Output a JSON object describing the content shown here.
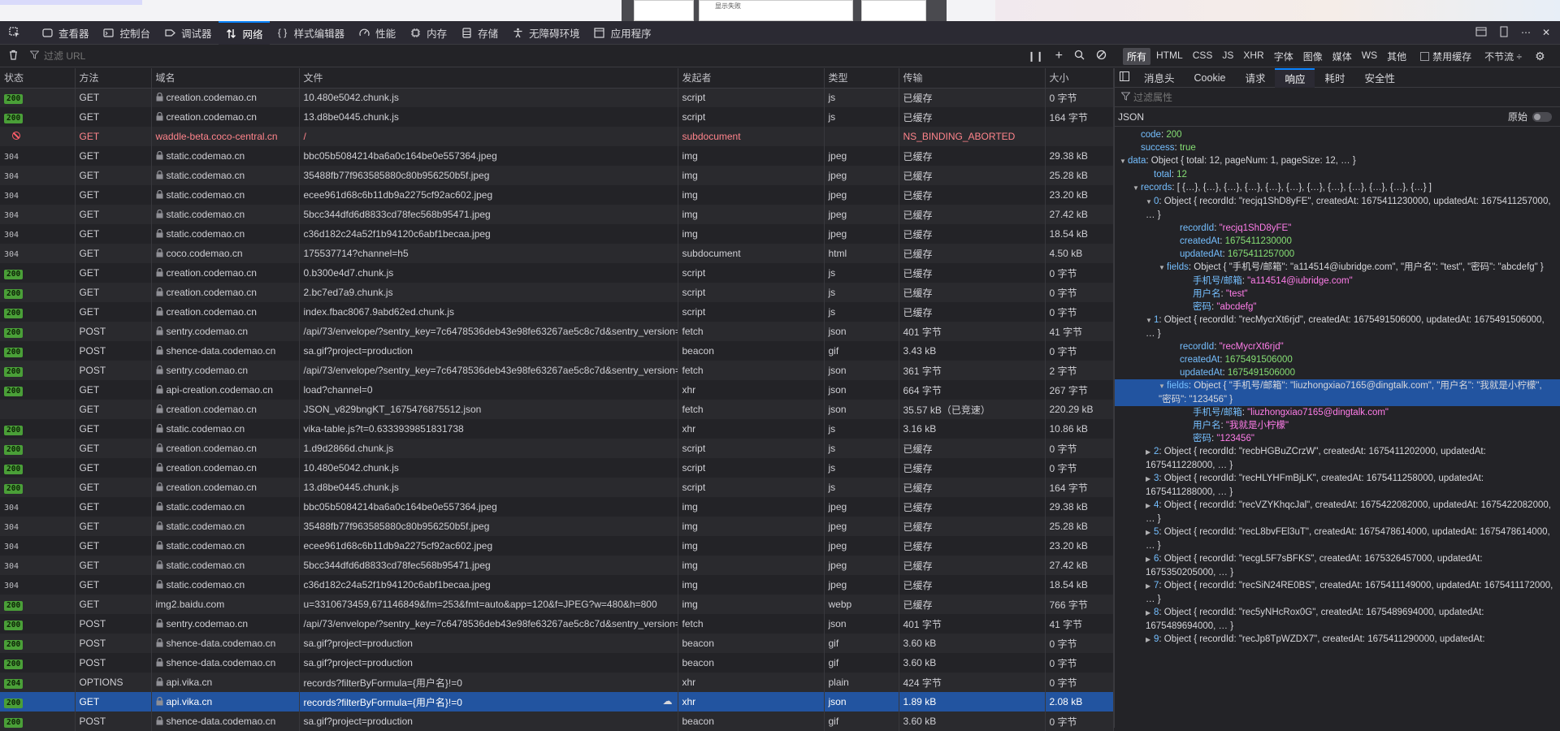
{
  "page_top": {
    "card_text": "显示失败"
  },
  "toolbar": {
    "tabs": [
      {
        "label": "查看器",
        "icon": "inspector-icon"
      },
      {
        "label": "控制台",
        "icon": "console-icon"
      },
      {
        "label": "调试器",
        "icon": "debugger-icon"
      },
      {
        "label": "网络",
        "icon": "network-icon",
        "selected": true
      },
      {
        "label": "样式编辑器",
        "icon": "style-editor-icon"
      },
      {
        "label": "性能",
        "icon": "performance-icon"
      },
      {
        "label": "内存",
        "icon": "memory-icon"
      },
      {
        "label": "存储",
        "icon": "storage-icon"
      },
      {
        "label": "无障碍环境",
        "icon": "accessibility-icon"
      },
      {
        "label": "应用程序",
        "icon": "application-icon"
      }
    ]
  },
  "filter": {
    "placeholder": "过滤 URL"
  },
  "type_filters": {
    "items": [
      "所有",
      "HTML",
      "CSS",
      "JS",
      "XHR",
      "字体",
      "图像",
      "媒体",
      "WS",
      "其他"
    ],
    "selected": "所有",
    "disable_cache": "禁用缓存",
    "throttle": "不节流 ÷"
  },
  "columns": {
    "status": "状态",
    "method": "方法",
    "domain": "域名",
    "file": "文件",
    "initiator": "发起者",
    "type": "类型",
    "transferred": "传输",
    "size": "大小"
  },
  "requests": [
    {
      "status": "200",
      "method": "GET",
      "domain": "creation.codemao.cn",
      "file": "10.480e5042.chunk.js",
      "initiator": "script",
      "type": "js",
      "transferred": "已缓存",
      "size": "0 字节"
    },
    {
      "status": "200",
      "method": "GET",
      "domain": "creation.codemao.cn",
      "file": "13.d8be0445.chunk.js",
      "initiator": "script",
      "type": "js",
      "transferred": "已缓存",
      "size": "164 字节"
    },
    {
      "status": "blocked",
      "method": "GET",
      "domain": "waddle-beta.coco-central.cn",
      "file": "/",
      "initiator": "subdocument",
      "type": "",
      "transferred": "NS_BINDING_ABORTED",
      "size": "",
      "nolock": true
    },
    {
      "status": "304",
      "method": "GET",
      "domain": "static.codemao.cn",
      "file": "bbc05b5084214ba6a0c164be0e557364.jpeg",
      "initiator": "img",
      "type": "jpeg",
      "transferred": "已缓存",
      "size": "29.38 kB"
    },
    {
      "status": "304",
      "method": "GET",
      "domain": "static.codemao.cn",
      "file": "35488fb77f963585880c80b956250b5f.jpeg",
      "initiator": "img",
      "type": "jpeg",
      "transferred": "已缓存",
      "size": "25.28 kB"
    },
    {
      "status": "304",
      "method": "GET",
      "domain": "static.codemao.cn",
      "file": "ecee961d68c6b11db9a2275cf92ac602.jpeg",
      "initiator": "img",
      "type": "jpeg",
      "transferred": "已缓存",
      "size": "23.20 kB"
    },
    {
      "status": "304",
      "method": "GET",
      "domain": "static.codemao.cn",
      "file": "5bcc344dfd6d8833cd78fec568b95471.jpeg",
      "initiator": "img",
      "type": "jpeg",
      "transferred": "已缓存",
      "size": "27.42 kB"
    },
    {
      "status": "304",
      "method": "GET",
      "domain": "static.codemao.cn",
      "file": "c36d182c24a52f1b94120c6abf1becaa.jpeg",
      "initiator": "img",
      "type": "jpeg",
      "transferred": "已缓存",
      "size": "18.54 kB"
    },
    {
      "status": "304",
      "method": "GET",
      "domain": "coco.codemao.cn",
      "file": "175537714?channel=h5",
      "initiator": "subdocument",
      "type": "html",
      "transferred": "已缓存",
      "size": "4.50 kB"
    },
    {
      "status": "200",
      "method": "GET",
      "domain": "creation.codemao.cn",
      "file": "0.b300e4d7.chunk.js",
      "initiator": "script",
      "type": "js",
      "transferred": "已缓存",
      "size": "0 字节"
    },
    {
      "status": "200",
      "method": "GET",
      "domain": "creation.codemao.cn",
      "file": "2.bc7ed7a9.chunk.js",
      "initiator": "script",
      "type": "js",
      "transferred": "已缓存",
      "size": "0 字节"
    },
    {
      "status": "200",
      "method": "GET",
      "domain": "creation.codemao.cn",
      "file": "index.fbac8067.9abd62ed.chunk.js",
      "initiator": "script",
      "type": "js",
      "transferred": "已缓存",
      "size": "0 字节"
    },
    {
      "status": "200",
      "method": "POST",
      "domain": "sentry.codemao.cn",
      "file": "/api/73/envelope/?sentry_key=7c6478536deb43e98fe63267ae5c8c7d&sentry_version=",
      "initiator": "fetch",
      "type": "json",
      "transferred": "401 字节",
      "size": "41 字节"
    },
    {
      "status": "200",
      "method": "POST",
      "domain": "shence-data.codemao.cn",
      "file": "sa.gif?project=production",
      "initiator": "beacon",
      "type": "gif",
      "transferred": "3.43 kB",
      "size": "0 字节"
    },
    {
      "status": "200",
      "method": "POST",
      "domain": "sentry.codemao.cn",
      "file": "/api/73/envelope/?sentry_key=7c6478536deb43e98fe63267ae5c8c7d&sentry_version=",
      "initiator": "fetch",
      "type": "json",
      "transferred": "361 字节",
      "size": "2 字节"
    },
    {
      "status": "200",
      "method": "GET",
      "domain": "api-creation.codemao.cn",
      "file": "load?channel=0",
      "initiator": "xhr",
      "type": "json",
      "transferred": "664 字节",
      "size": "267 字节"
    },
    {
      "status": "",
      "method": "GET",
      "domain": "creation.codemao.cn",
      "file": "JSON_v829bngKT_1675476875512.json",
      "initiator": "fetch",
      "type": "json",
      "transferred": "35.57 kB（已竞速）",
      "size": "220.29 kB"
    },
    {
      "status": "200",
      "method": "GET",
      "domain": "static.codemao.cn",
      "file": "vika-table.js?t=0.6333939851831738",
      "initiator": "xhr",
      "type": "js",
      "transferred": "3.16 kB",
      "size": "10.86 kB"
    },
    {
      "status": "200",
      "method": "GET",
      "domain": "creation.codemao.cn",
      "file": "1.d9d2866d.chunk.js",
      "initiator": "script",
      "type": "js",
      "transferred": "已缓存",
      "size": "0 字节"
    },
    {
      "status": "200",
      "method": "GET",
      "domain": "creation.codemao.cn",
      "file": "10.480e5042.chunk.js",
      "initiator": "script",
      "type": "js",
      "transferred": "已缓存",
      "size": "0 字节"
    },
    {
      "status": "200",
      "method": "GET",
      "domain": "creation.codemao.cn",
      "file": "13.d8be0445.chunk.js",
      "initiator": "script",
      "type": "js",
      "transferred": "已缓存",
      "size": "164 字节"
    },
    {
      "status": "304",
      "method": "GET",
      "domain": "static.codemao.cn",
      "file": "bbc05b5084214ba6a0c164be0e557364.jpeg",
      "initiator": "img",
      "type": "jpeg",
      "transferred": "已缓存",
      "size": "29.38 kB"
    },
    {
      "status": "304",
      "method": "GET",
      "domain": "static.codemao.cn",
      "file": "35488fb77f963585880c80b956250b5f.jpeg",
      "initiator": "img",
      "type": "jpeg",
      "transferred": "已缓存",
      "size": "25.28 kB"
    },
    {
      "status": "304",
      "method": "GET",
      "domain": "static.codemao.cn",
      "file": "ecee961d68c6b11db9a2275cf92ac602.jpeg",
      "initiator": "img",
      "type": "jpeg",
      "transferred": "已缓存",
      "size": "23.20 kB"
    },
    {
      "status": "304",
      "method": "GET",
      "domain": "static.codemao.cn",
      "file": "5bcc344dfd6d8833cd78fec568b95471.jpeg",
      "initiator": "img",
      "type": "jpeg",
      "transferred": "已缓存",
      "size": "27.42 kB"
    },
    {
      "status": "304",
      "method": "GET",
      "domain": "static.codemao.cn",
      "file": "c36d182c24a52f1b94120c6abf1becaa.jpeg",
      "initiator": "img",
      "type": "jpeg",
      "transferred": "已缓存",
      "size": "18.54 kB"
    },
    {
      "status": "200",
      "method": "GET",
      "domain": "img2.baidu.com",
      "file": "u=3310673459,671146849&fm=253&fmt=auto&app=120&f=JPEG?w=480&h=800",
      "initiator": "img",
      "type": "webp",
      "transferred": "已缓存",
      "size": "766 字节",
      "nolock": true
    },
    {
      "status": "200",
      "method": "POST",
      "domain": "sentry.codemao.cn",
      "file": "/api/73/envelope/?sentry_key=7c6478536deb43e98fe63267ae5c8c7d&sentry_version=",
      "initiator": "fetch",
      "type": "json",
      "transferred": "401 字节",
      "size": "41 字节"
    },
    {
      "status": "200",
      "method": "POST",
      "domain": "shence-data.codemao.cn",
      "file": "sa.gif?project=production",
      "initiator": "beacon",
      "type": "gif",
      "transferred": "3.60 kB",
      "size": "0 字节"
    },
    {
      "status": "200",
      "method": "POST",
      "domain": "shence-data.codemao.cn",
      "file": "sa.gif?project=production",
      "initiator": "beacon",
      "type": "gif",
      "transferred": "3.60 kB",
      "size": "0 字节"
    },
    {
      "status": "204",
      "method": "OPTIONS",
      "domain": "api.vika.cn",
      "file": "records?filterByFormula={用户名}!=0",
      "initiator": "xhr",
      "type": "plain",
      "transferred": "424 字节",
      "size": "0 字节"
    },
    {
      "status": "200",
      "method": "GET",
      "domain": "api.vika.cn",
      "file": "records?filterByFormula={用户名}!=0",
      "initiator": "xhr",
      "type": "json",
      "transferred": "1.89 kB",
      "size": "2.08 kB",
      "selected": true
    },
    {
      "status": "200",
      "method": "POST",
      "domain": "shence-data.codemao.cn",
      "file": "sa.gif?project=production",
      "initiator": "beacon",
      "type": "gif",
      "transferred": "3.60 kB",
      "size": "0 字节"
    }
  ],
  "side": {
    "tabs": [
      "消息头",
      "Cookie",
      "请求",
      "响应",
      "耗时",
      "安全性"
    ],
    "selected_tab": "响应",
    "filter_placeholder": "过滤属性",
    "json_label": "JSON",
    "raw_label": "原始",
    "tree": [
      {
        "indent": 1,
        "arrow": "",
        "key": "code",
        "sep": ": ",
        "value": "200",
        "vt": "num"
      },
      {
        "indent": 1,
        "arrow": "",
        "key": "success",
        "sep": ": ",
        "value": "true",
        "vt": "bool"
      },
      {
        "indent": 0,
        "arrow": "▼",
        "key": "data",
        "sep": ": ",
        "value": "Object { total: 12, pageNum: 1, pageSize: 12, … }",
        "vt": "obj"
      },
      {
        "indent": 2,
        "arrow": "",
        "key": "total",
        "sep": ": ",
        "value": "12",
        "vt": "num"
      },
      {
        "indent": 1,
        "arrow": "▼",
        "key": "records",
        "sep": ": ",
        "value": "[ {…}, {…}, {…}, {…}, {…}, {…}, {…}, {…}, {…}, {…}, {…}, {…} ]",
        "vt": "obj"
      },
      {
        "indent": 2,
        "arrow": "▼",
        "key": "0",
        "sep": ": ",
        "value": "Object { recordId: \"recjq1ShD8yFE\", createdAt: 1675411230000, updatedAt: 1675411257000, … }",
        "vt": "obj",
        "wrap": true
      },
      {
        "indent": 4,
        "arrow": "",
        "key": "recordId",
        "sep": ": ",
        "value": "\"recjq1ShD8yFE\"",
        "vt": "str"
      },
      {
        "indent": 4,
        "arrow": "",
        "key": "createdAt",
        "sep": ": ",
        "value": "1675411230000",
        "vt": "num"
      },
      {
        "indent": 4,
        "arrow": "",
        "key": "updatedAt",
        "sep": ": ",
        "value": "1675411257000",
        "vt": "num"
      },
      {
        "indent": 3,
        "arrow": "▼",
        "key": "fields",
        "sep": ": ",
        "value": "Object { \"手机号/邮箱\": \"a114514@iubridge.com\", \"用户名\": \"test\", \"密码\": \"abcdefg\" }",
        "vt": "obj"
      },
      {
        "indent": 5,
        "arrow": "",
        "key": "手机号/邮箱",
        "sep": ": ",
        "value": "\"a114514@iubridge.com\"",
        "vt": "str"
      },
      {
        "indent": 5,
        "arrow": "",
        "key": "用户名",
        "sep": ": ",
        "value": "\"test\"",
        "vt": "str"
      },
      {
        "indent": 5,
        "arrow": "",
        "key": "密码",
        "sep": ": ",
        "value": "\"abcdefg\"",
        "vt": "str"
      },
      {
        "indent": 2,
        "arrow": "▼",
        "key": "1",
        "sep": ": ",
        "value": "Object { recordId: \"recMycrXt6rjd\", createdAt: 1675491506000, updatedAt: 1675491506000, … }",
        "vt": "obj",
        "wrap": true
      },
      {
        "indent": 4,
        "arrow": "",
        "key": "recordId",
        "sep": ": ",
        "value": "\"recMycrXt6rjd\"",
        "vt": "str"
      },
      {
        "indent": 4,
        "arrow": "",
        "key": "createdAt",
        "sep": ": ",
        "value": "1675491506000",
        "vt": "num"
      },
      {
        "indent": 4,
        "arrow": "",
        "key": "updatedAt",
        "sep": ": ",
        "value": "1675491506000",
        "vt": "num"
      },
      {
        "indent": 3,
        "arrow": "▼",
        "key": "fields",
        "sep": ": ",
        "value": "Object { \"手机号/邮箱\": \"liuzhongxiao7165@dingtalk.com\", \"用户名\": \"我就是小柠檬\", \"密码\": \"123456\" }",
        "vt": "obj",
        "wrap": true,
        "hl": true
      },
      {
        "indent": 5,
        "arrow": "",
        "key": "手机号/邮箱",
        "sep": ": ",
        "value": "\"liuzhongxiao7165@dingtalk.com\"",
        "vt": "str"
      },
      {
        "indent": 5,
        "arrow": "",
        "key": "用户名",
        "sep": ": ",
        "value": "\"我就是小柠檬\"",
        "vt": "str"
      },
      {
        "indent": 5,
        "arrow": "",
        "key": "密码",
        "sep": ": ",
        "value": "\"123456\"",
        "vt": "str"
      },
      {
        "indent": 2,
        "arrow": "▶",
        "key": "2",
        "sep": ": ",
        "value": "Object { recordId: \"recbHGBuZCrzW\", createdAt: 1675411202000, updatedAt: 1675411228000, … }",
        "vt": "obj",
        "wrap": true
      },
      {
        "indent": 2,
        "arrow": "▶",
        "key": "3",
        "sep": ": ",
        "value": "Object { recordId: \"recHLYHFmBjLK\", createdAt: 1675411258000, updatedAt: 1675411288000, … }",
        "vt": "obj",
        "wrap": true
      },
      {
        "indent": 2,
        "arrow": "▶",
        "key": "4",
        "sep": ": ",
        "value": "Object { recordId: \"recVZYKhqcJal\", createdAt: 1675422082000, updatedAt: 1675422082000, … }",
        "vt": "obj",
        "wrap": true
      },
      {
        "indent": 2,
        "arrow": "▶",
        "key": "5",
        "sep": ": ",
        "value": "Object { recordId: \"recL8bvFEl3uT\", createdAt: 1675478614000, updatedAt: 1675478614000, … }",
        "vt": "obj",
        "wrap": true
      },
      {
        "indent": 2,
        "arrow": "▶",
        "key": "6",
        "sep": ": ",
        "value": "Object { recordId: \"recgL5F7sBFKS\", createdAt: 1675326457000, updatedAt: 1675350205000, … }",
        "vt": "obj",
        "wrap": true
      },
      {
        "indent": 2,
        "arrow": "▶",
        "key": "7",
        "sep": ": ",
        "value": "Object { recordId: \"recSiN24RE0BS\", createdAt: 1675411149000, updatedAt: 1675411172000, … }",
        "vt": "obj",
        "wrap": true
      },
      {
        "indent": 2,
        "arrow": "▶",
        "key": "8",
        "sep": ": ",
        "value": "Object { recordId: \"rec5yNHcRox0G\", createdAt: 1675489694000, updatedAt: 1675489694000, … }",
        "vt": "obj",
        "wrap": true
      },
      {
        "indent": 2,
        "arrow": "▶",
        "key": "9",
        "sep": ": ",
        "value": "Object { recordId: \"recJp8TpWZDX7\", createdAt: 1675411290000, updatedAt:",
        "vt": "obj",
        "wrap": true
      }
    ]
  }
}
